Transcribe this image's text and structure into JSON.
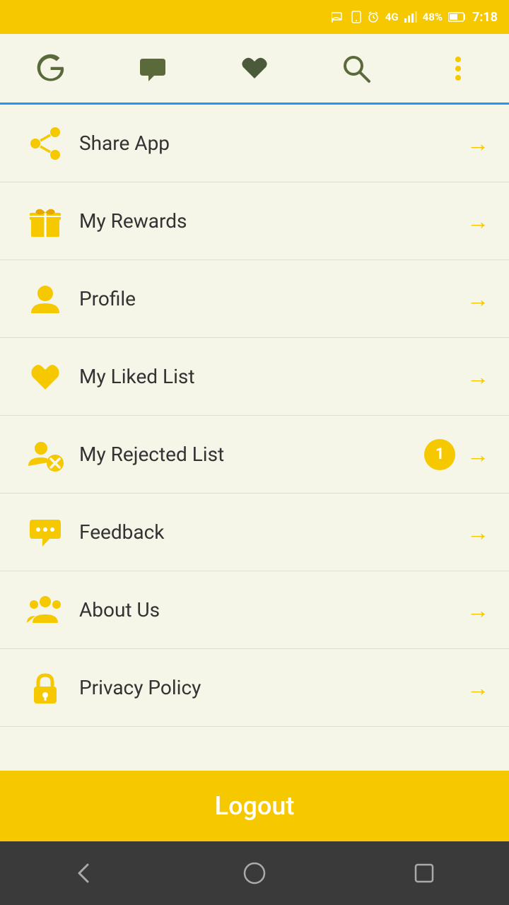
{
  "statusBar": {
    "battery": "48%",
    "time": "7:18",
    "network": "4G"
  },
  "nav": {
    "items": [
      {
        "name": "logo",
        "label": "G logo"
      },
      {
        "name": "chat",
        "label": "Chat"
      },
      {
        "name": "heart",
        "label": "Heart"
      },
      {
        "name": "search",
        "label": "Search"
      },
      {
        "name": "more",
        "label": "More"
      }
    ]
  },
  "menu": {
    "items": [
      {
        "id": "share-app",
        "label": "Share App",
        "badge": null,
        "icon": "share"
      },
      {
        "id": "my-rewards",
        "label": "My Rewards",
        "badge": null,
        "icon": "gift"
      },
      {
        "id": "profile",
        "label": "Profile",
        "badge": null,
        "icon": "person"
      },
      {
        "id": "my-liked-list",
        "label": "My Liked List",
        "badge": null,
        "icon": "heart"
      },
      {
        "id": "my-rejected-list",
        "label": "My Rejected List",
        "badge": "1",
        "icon": "reject"
      },
      {
        "id": "feedback",
        "label": "Feedback",
        "badge": null,
        "icon": "chat"
      },
      {
        "id": "about-us",
        "label": "About Us",
        "badge": null,
        "icon": "group"
      },
      {
        "id": "privacy-policy",
        "label": "Privacy Policy",
        "badge": null,
        "icon": "lock"
      }
    ],
    "logout_label": "Logout"
  },
  "bottomNav": {
    "back": "‹",
    "home": "○",
    "recent": "□"
  }
}
